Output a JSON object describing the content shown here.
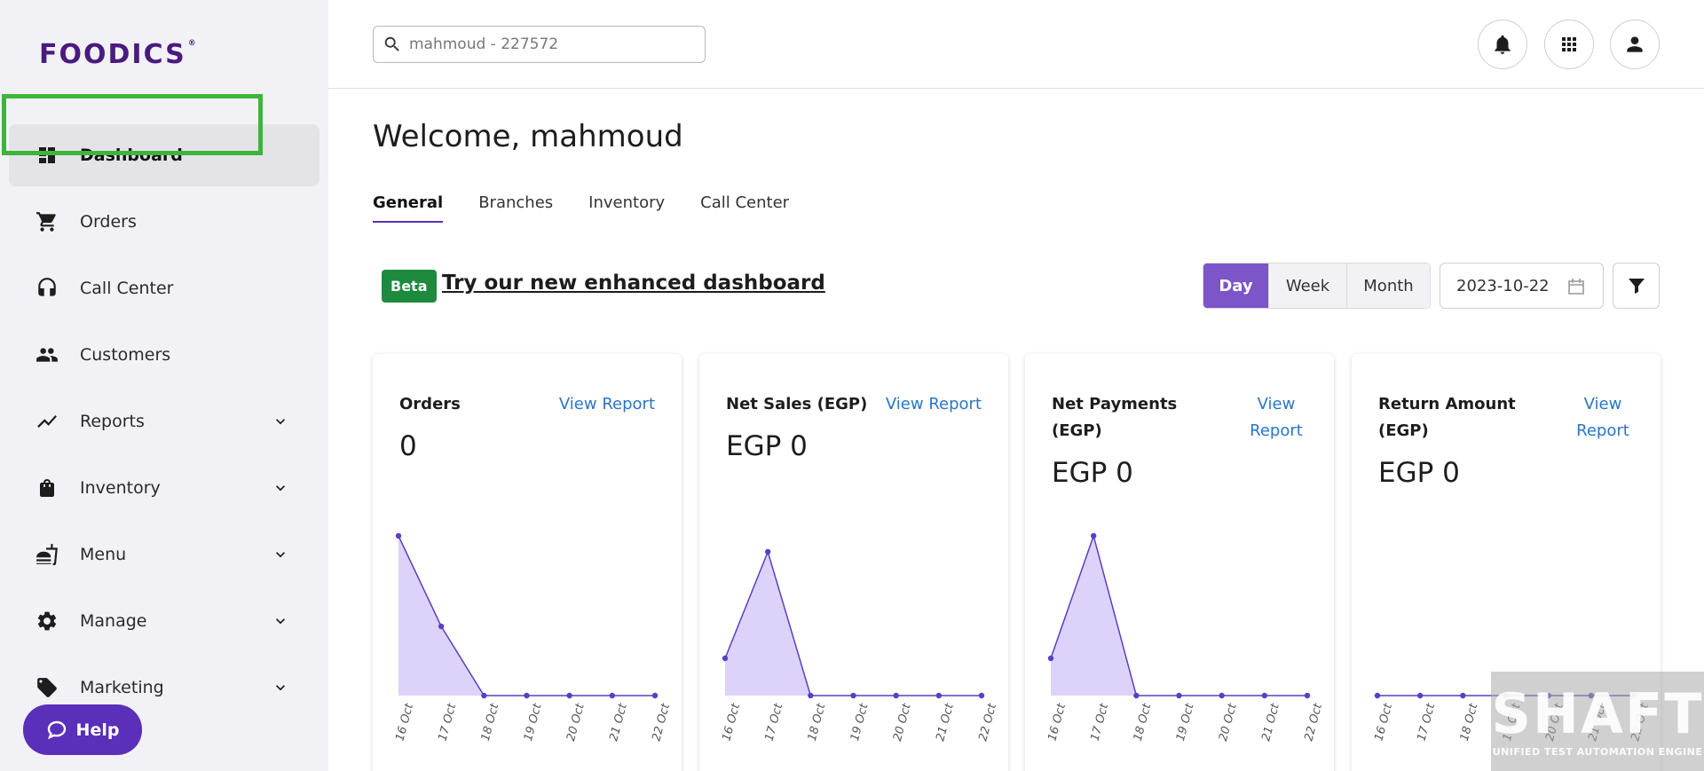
{
  "app": {
    "logo": "FOODICS",
    "logo_mark": "®"
  },
  "sidebar": {
    "items": [
      {
        "label": "Dashboard",
        "icon": "dashboard-icon",
        "active": true,
        "expandable": false
      },
      {
        "label": "Orders",
        "icon": "cart-icon",
        "active": false,
        "expandable": false
      },
      {
        "label": "Call Center",
        "icon": "headset-icon",
        "active": false,
        "expandable": false
      },
      {
        "label": "Customers",
        "icon": "people-icon",
        "active": false,
        "expandable": false
      },
      {
        "label": "Reports",
        "icon": "trending-icon",
        "active": false,
        "expandable": true
      },
      {
        "label": "Inventory",
        "icon": "bag-icon",
        "active": false,
        "expandable": true
      },
      {
        "label": "Menu",
        "icon": "menu-food-icon",
        "active": false,
        "expandable": true
      },
      {
        "label": "Manage",
        "icon": "gear-icon",
        "active": false,
        "expandable": true
      },
      {
        "label": "Marketing",
        "icon": "tag-icon",
        "active": false,
        "expandable": true
      }
    ],
    "help_label": "Help"
  },
  "topbar": {
    "search_value": "mahmoud - 227572"
  },
  "main": {
    "welcome": "Welcome, mahmoud",
    "tabs": [
      {
        "label": "General",
        "active": true
      },
      {
        "label": "Branches",
        "active": false
      },
      {
        "label": "Inventory",
        "active": false
      },
      {
        "label": "Call Center",
        "active": false
      }
    ],
    "beta_badge": "Beta",
    "try_link": "Try our new enhanced dashboard",
    "periods": [
      {
        "label": "Day",
        "active": true
      },
      {
        "label": "Week",
        "active": false
      },
      {
        "label": "Month",
        "active": false
      }
    ],
    "date": "2023-10-22"
  },
  "cards": [
    {
      "title": "Orders",
      "view_report": "View Report",
      "value": "0"
    },
    {
      "title": "Net Sales (EGP)",
      "view_report": "View Report",
      "value": "EGP 0"
    },
    {
      "title": "Net Payments (EGP)",
      "view_report": "View Report",
      "value": "EGP 0"
    },
    {
      "title": "Return Amount (EGP)",
      "view_report": "View Report",
      "value": "EGP 0"
    }
  ],
  "chart_data": [
    {
      "type": "area",
      "x": [
        "16 Oct",
        "17 Oct",
        "18 Oct",
        "19 Oct",
        "20 Oct",
        "21 Oct",
        "22 Oct"
      ],
      "values": [
        3,
        1.3,
        0,
        0,
        0,
        0,
        0
      ]
    },
    {
      "type": "area",
      "x": [
        "16 Oct",
        "17 Oct",
        "18 Oct",
        "19 Oct",
        "20 Oct",
        "21 Oct",
        "22 Oct"
      ],
      "values": [
        0.7,
        2.7,
        0,
        0,
        0,
        0,
        0
      ]
    },
    {
      "type": "area",
      "x": [
        "16 Oct",
        "17 Oct",
        "18 Oct",
        "19 Oct",
        "20 Oct",
        "21 Oct",
        "22 Oct"
      ],
      "values": [
        0.7,
        3,
        0,
        0,
        0,
        0,
        0
      ]
    },
    {
      "type": "area",
      "x": [
        "16 Oct",
        "17 Oct",
        "18 Oct",
        "19 Oct",
        "20 Oct",
        "21 Oct",
        "22 Oct"
      ],
      "values": [
        0,
        0,
        0,
        0,
        0,
        0,
        0
      ]
    }
  ],
  "colors": {
    "accent": "#5a2fb9",
    "area_fill": "#dcd2fa",
    "line": "#5a3fc0",
    "link": "#2a75c7",
    "beta": "#1e8a3e",
    "highlight": "#3db53a"
  },
  "watermark": {
    "title": "SHAFT",
    "subtitle": "UNIFIED TEST AUTOMATION ENGINE"
  }
}
